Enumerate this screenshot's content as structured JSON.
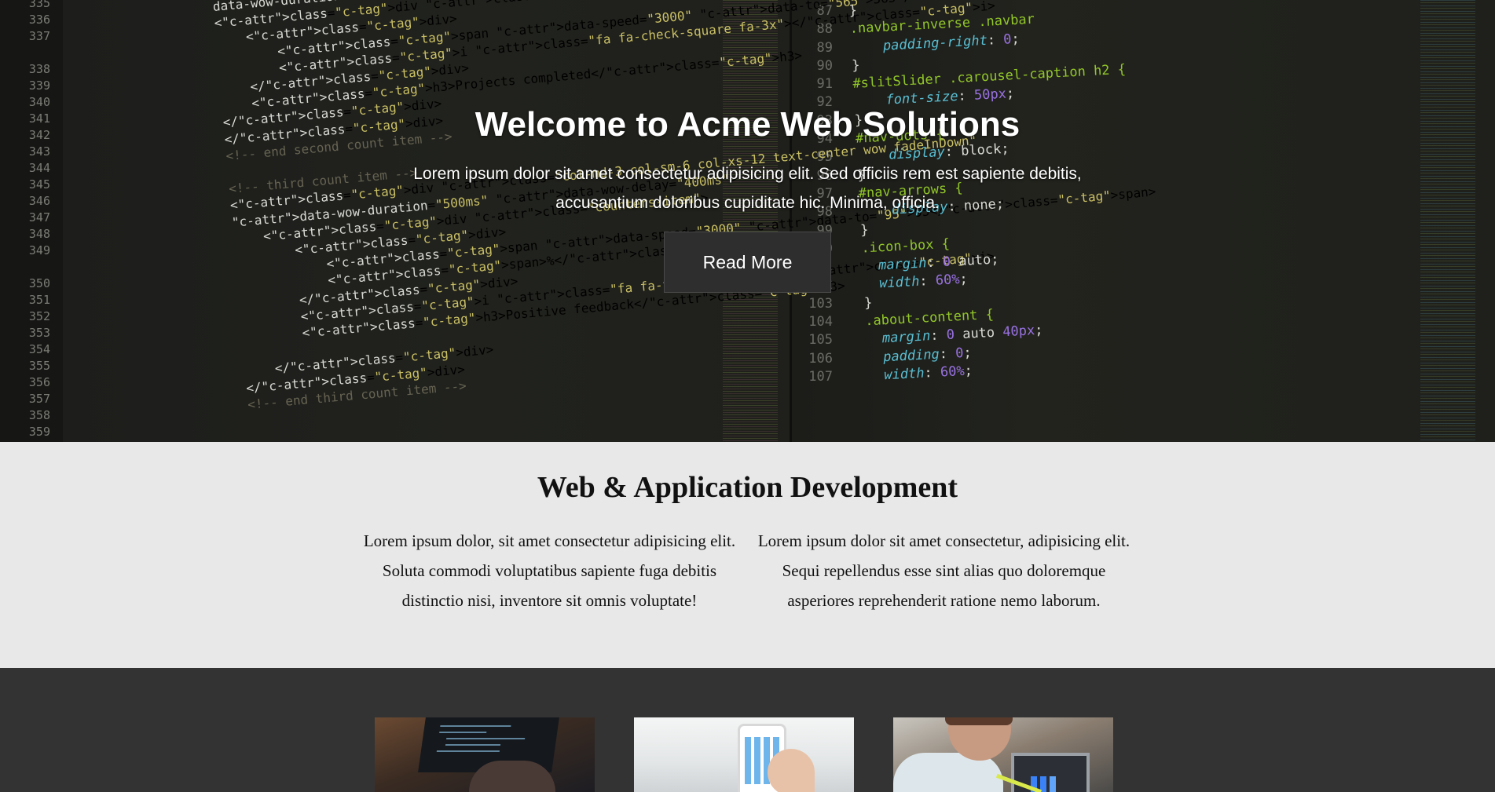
{
  "hero": {
    "title": "Welcome to Acme Web Solutions",
    "text": "Lorem ipsum dolor sit amet consectetur adipisicing elit. Sed officiis rem est sapiente debitis, accusantium doloribus cupiditate hic. Minima, officia.",
    "button_label": "Read More",
    "background": {
      "left_line_numbers": [
        "335",
        "336",
        "337",
        "",
        "338",
        "339",
        "340",
        "341",
        "342",
        "343",
        "344",
        "345",
        "346",
        "347",
        "348",
        "349",
        "",
        "350",
        "351",
        "352",
        "353",
        "354",
        "355",
        "356",
        "357",
        "358",
        "359"
      ],
      "right_line_numbers": [
        "87",
        "88",
        "89",
        "90",
        "91",
        "92",
        "93",
        "94",
        "95",
        "96",
        "97",
        "98",
        "99",
        "100",
        "101",
        "102",
        "103",
        "104",
        "105",
        "106",
        "107"
      ],
      "left_code": [
        "data-wow-duration",
        "<div class=\"counters-item\">",
        "    <div>",
        "        <span data-speed=\"3000\" data-to=\"565\">565</span>",
        "        <i class=\"fa fa-check-square fa-3x\"></i>",
        "    </div>",
        "    <h3>Projects completed</h3>",
        "</div>",
        "</div>",
        "<!-- end second count item -->",
        "",
        "<!-- third count item -->",
        "<div class=\"col-md-3 col-sm-6 col-xs-12 text-center wow fadeInDown\"",
        "data-wow-duration=\"500ms\" data-wow-delay=\"400ms\">",
        "    <div class=\"counters-item\">",
        "        <div>",
        "            <span data-speed=\"3000\" data-to=\"95\">95</span>",
        "            <span>%</span>",
        "        </div>",
        "        <i class=\"fa fa-thumbs-up fa-3x\"></i>",
        "        <h3>Positive feedback</h3>",
        "",
        "    </div>",
        "</div>",
        "<!-- end third count item -->"
      ],
      "right_code": [
        "}",
        ".navbar-inverse .navbar",
        "    padding-right: 0;",
        "}",
        "#slitSlider .carousel-caption h2 {",
        "    font-size: 50px;",
        "}",
        "#nav-dots {",
        "    display: block;",
        "}",
        "#nav-arrows {",
        "    display: none;",
        "}",
        ".icon-box {",
        "  margin: 0 auto;",
        "  width: 60%;",
        "}",
        ".about-content {",
        "  margin: 0 auto 40px;",
        "  padding: 0;",
        "  width: 60%;"
      ]
    }
  },
  "services": {
    "title": "Web & Application Development",
    "col1": "Lorem ipsum dolor, sit amet consectetur adipisicing elit. Soluta commodi voluptatibus sapiente fuga debitis distinctio nisi, inventore sit omnis voluptate!",
    "col2": "Lorem ipsum dolor sit amet consectetur, adipisicing elit. Sequi repellendus esse sint alias quo doloremque asperiores reprehenderit ratione nemo laborum."
  },
  "colors": {
    "hero_bg": "#272822",
    "button_bg": "#2e2e2e",
    "services_bg": "#e8e8e8",
    "gallery_bg": "#333333"
  },
  "gallery": {
    "images": [
      {
        "name": "laptop-code-photo"
      },
      {
        "name": "smartphone-photo"
      },
      {
        "name": "analytics-laptop-photo"
      }
    ]
  }
}
